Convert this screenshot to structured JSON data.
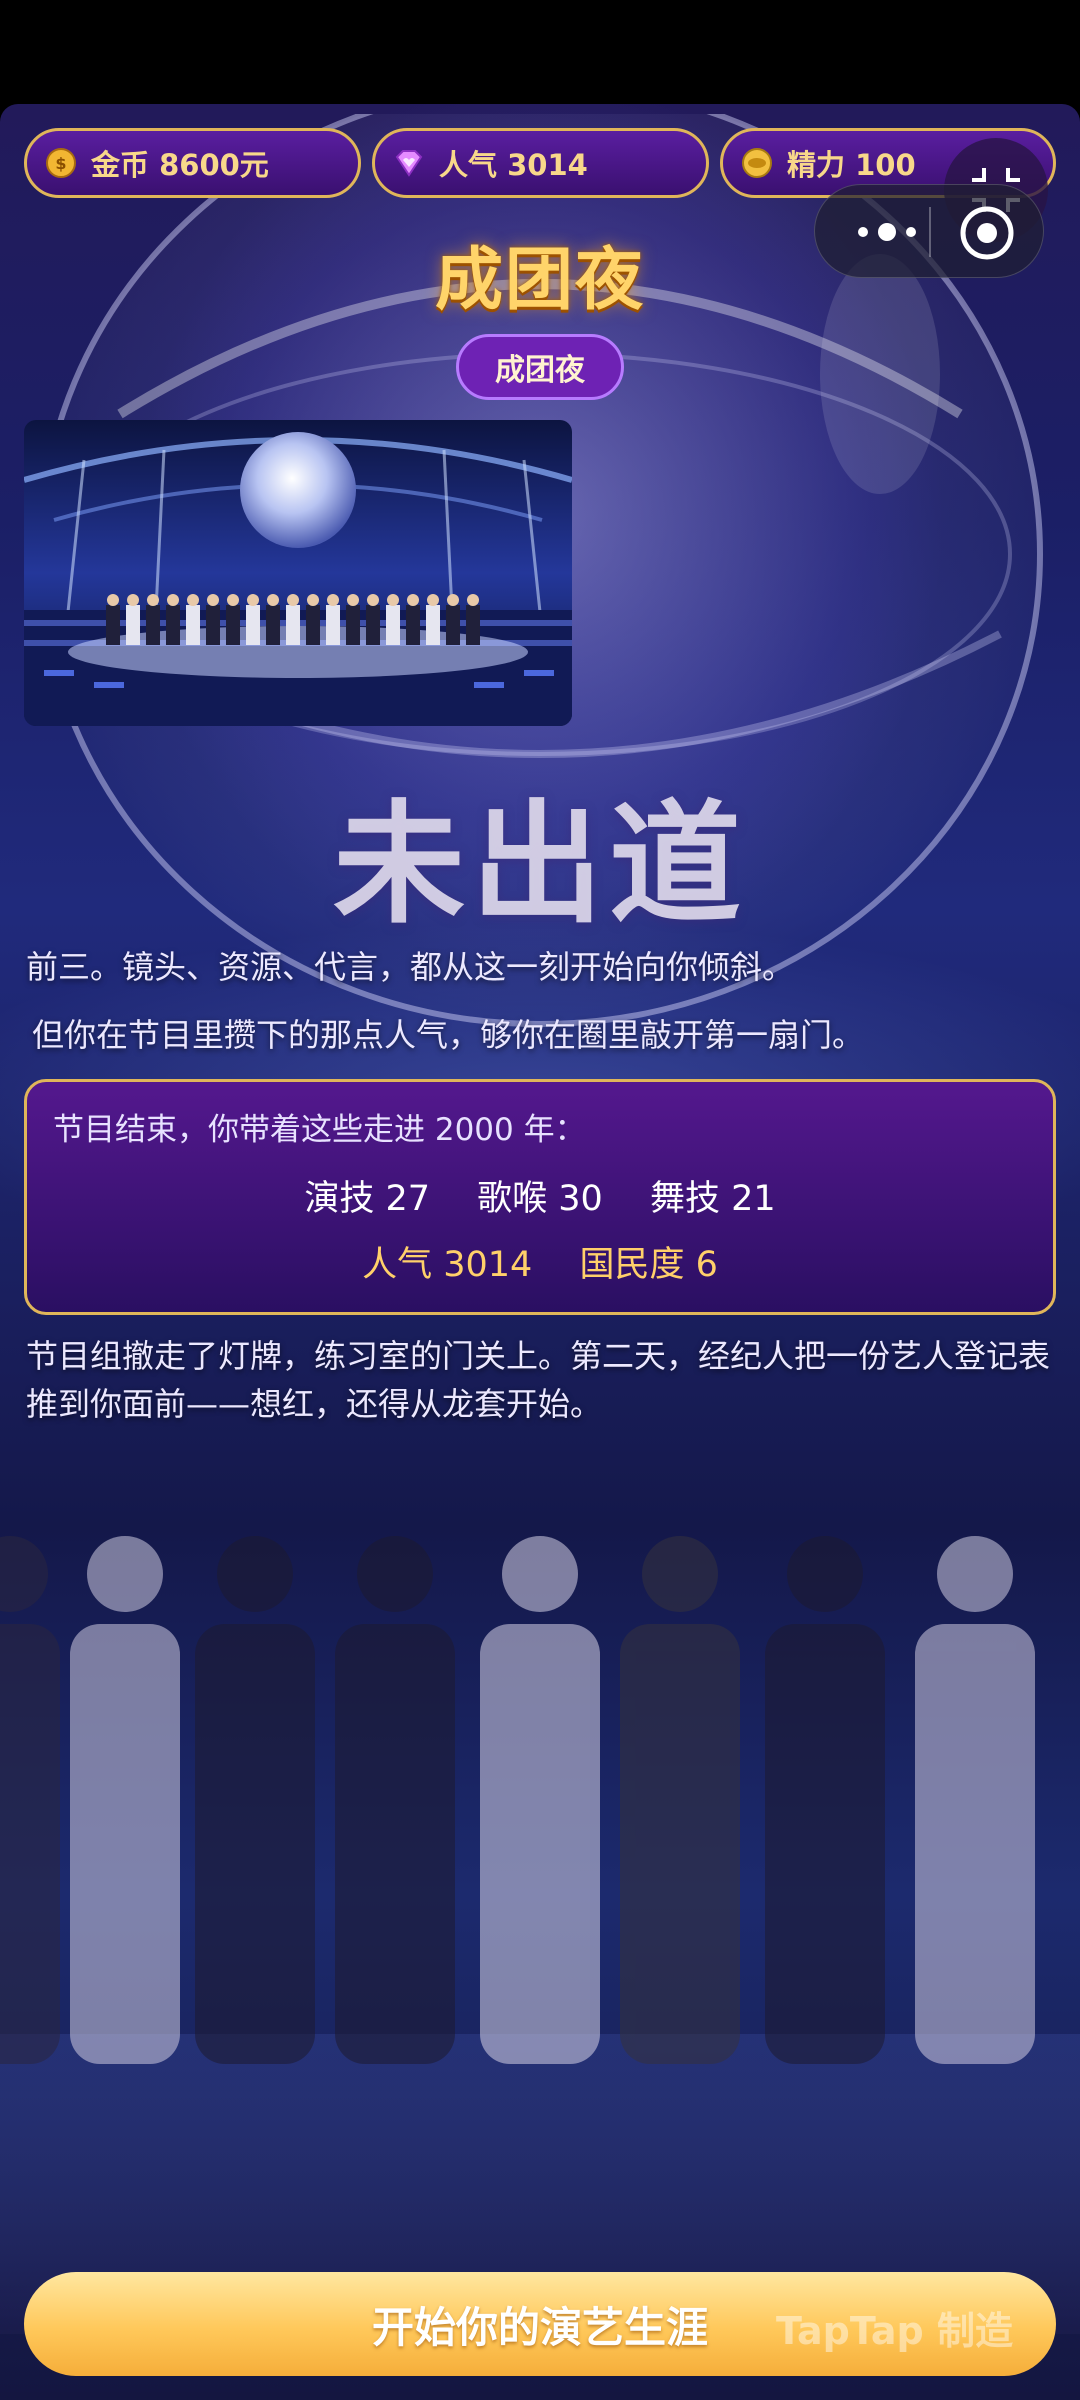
{
  "resources": {
    "coins": "金币 8600元",
    "popularity": "人气 3014",
    "energy": "精力 100"
  },
  "header": {
    "title": "成团夜",
    "chapter_badge": "成团夜"
  },
  "result": {
    "status": "未出道",
    "paragraph1": "前三。镜头、资源、代言，都从这一刻开始向你倾斜。",
    "paragraph2": "但你在节目里攒下的那点人气，够你在圈里敲开第一扇门。"
  },
  "summary": {
    "intro": "节目结束，你带着这些走进 2000 年：",
    "acting": "演技 27",
    "singing": "歌喉 30",
    "dancing": "舞技 21",
    "popularity": "人气 3014",
    "national_fame": "国民度 6"
  },
  "epilogue": "节目组撤走了灯牌，练习室的门关上。第二天，经纪人把一份艺人登记表推到你面前——想红，还得从龙套开始。",
  "actions": {
    "start_label": "开始你的演艺生涯"
  },
  "watermark": "TapTap 制造",
  "colors": {
    "gold": "#e0b65a",
    "title_gold": "#ffd46a",
    "purple": "#5a1ea0",
    "button_gold": "#ffc85a"
  },
  "icons": {
    "coins": "coin-icon",
    "popularity": "heart-gem-icon",
    "energy": "energy-icon"
  }
}
